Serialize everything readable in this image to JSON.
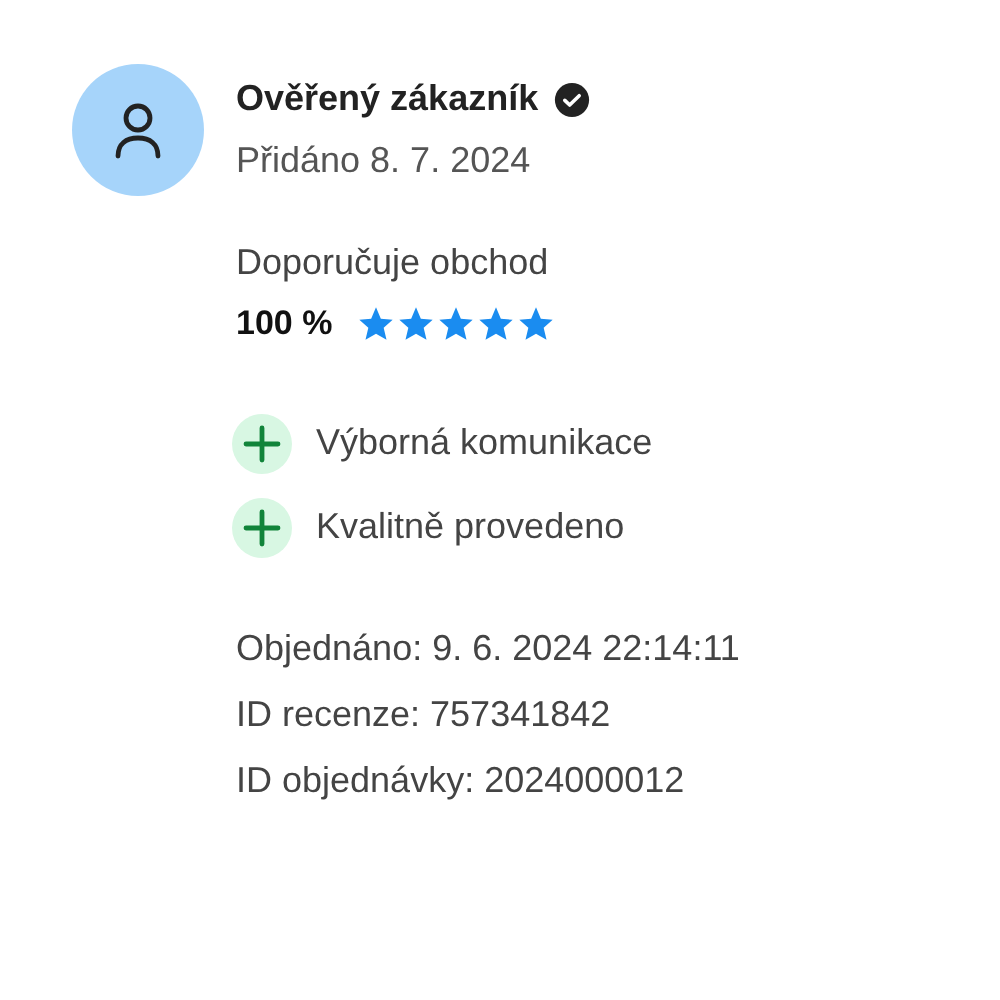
{
  "reviewer": {
    "name": "Ověřený zákazník",
    "verified": true,
    "added": "Přidáno 8. 7. 2024"
  },
  "recommendation": {
    "label": "Doporučuje obchod",
    "percent": "100 %",
    "stars": 5
  },
  "pros": [
    "Výborná komunikace",
    "Kvalitně provedeno"
  ],
  "details": [
    "Objednáno: 9. 6. 2024 22:14:11",
    "ID recenze: 757341842",
    "ID objednávky: 2024000012"
  ]
}
